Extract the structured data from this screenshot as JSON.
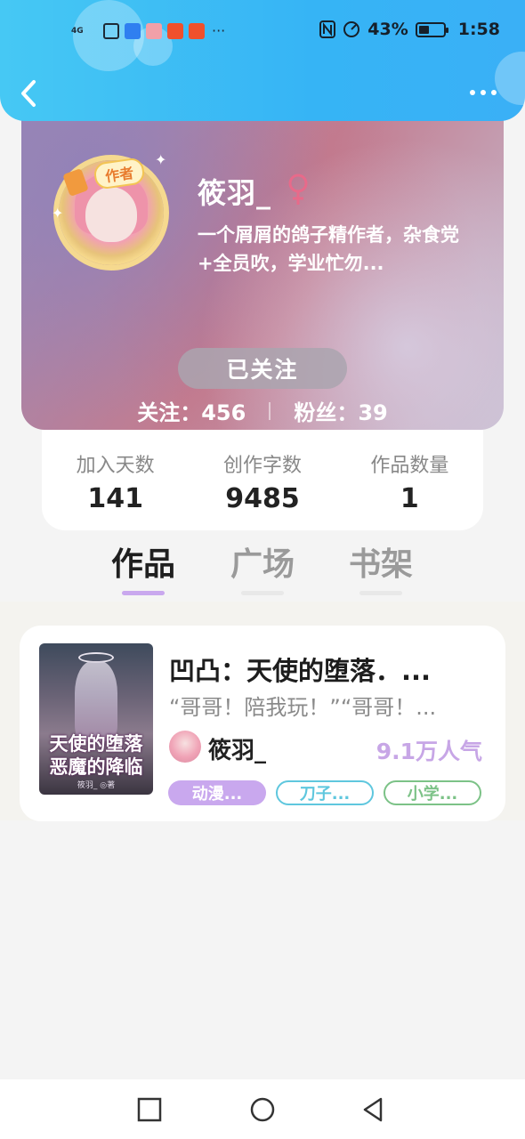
{
  "status_bar": {
    "battery": "43%",
    "battery_level": 0.43,
    "time": "1:58",
    "more": "···",
    "network": "4G"
  },
  "header": {
    "back_icon": "chevron-left-icon",
    "more_icon": "more-horizontal-icon"
  },
  "profile": {
    "badge": "作者",
    "name": "筱羽_",
    "gender_icon": "female-icon",
    "bio": "一个屑屑的鸽子精作者，杂食党+全员吹，学业忙勿...",
    "follow_button": "已关注",
    "following_text": "关注：456",
    "followers_text": "粉丝：39"
  },
  "stats": [
    {
      "label": "加入天数",
      "value": "141"
    },
    {
      "label": "创作字数",
      "value": "9485"
    },
    {
      "label": "作品数量",
      "value": "1"
    }
  ],
  "tabs": [
    {
      "label": "作品",
      "active": true
    },
    {
      "label": "广场",
      "active": false
    },
    {
      "label": "书架",
      "active": false
    }
  ],
  "work": {
    "title": "凹凸：天使的堕落．...",
    "excerpt": "“哥哥！陪我玩！”“哥哥！...",
    "author": "筱羽_",
    "popularity": "9.1万人气",
    "cover_title_line1": "天使的堕落",
    "cover_title_line2": "恶魔的降临",
    "cover_author": "筱羽_ ◎著",
    "tags": [
      {
        "label": "动漫...",
        "color": "#c9a8ee",
        "style": "filled"
      },
      {
        "label": "刀子...",
        "color": "#5fc7de",
        "style": "outline"
      },
      {
        "label": "小学...",
        "color": "#7cc287",
        "style": "outline"
      }
    ]
  },
  "nav": {
    "recent_icon": "square-icon",
    "home_icon": "circle-icon",
    "back_icon": "triangle-back-icon"
  },
  "colors": {
    "header_blue": "#3ab5f5",
    "tab_active_indicator": "#c9a8ee",
    "popularity": "#c7a6e6"
  }
}
